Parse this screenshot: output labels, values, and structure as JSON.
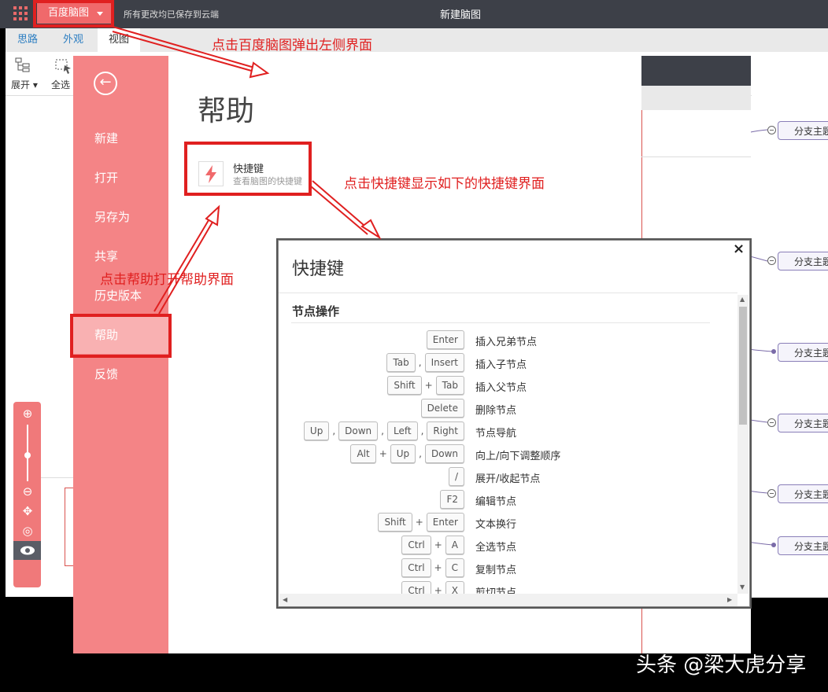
{
  "topbar": {
    "brand": "百度脑图",
    "saved_status": "所有更改均已保存到云端",
    "doc_title": "新建脑图"
  },
  "tabs": [
    {
      "label": "思路"
    },
    {
      "label": "外观"
    },
    {
      "label": "视图"
    }
  ],
  "toolbar": {
    "expand_label": "展开",
    "select_all_label": "全选"
  },
  "sidebar": {
    "items": [
      {
        "label": "新建"
      },
      {
        "label": "打开"
      },
      {
        "label": "另存为"
      },
      {
        "label": "共享"
      },
      {
        "label": "历史版本"
      },
      {
        "label": "帮助"
      },
      {
        "label": "反馈"
      }
    ]
  },
  "help_panel": {
    "title": "帮助",
    "shortcut_card": {
      "title": "快捷键",
      "subtitle": "查看脑图的快捷键"
    }
  },
  "annotations": {
    "a1": "点击百度脑图弹出左侧界面",
    "a2": "点击快捷键显示如下的快捷键界面",
    "a3": "点击帮助打开帮助界面"
  },
  "dialog": {
    "title": "快捷键",
    "close": "×",
    "section": "节点操作",
    "rows": [
      {
        "keys": [
          "Enter"
        ],
        "seps": [],
        "desc": "插入兄弟节点"
      },
      {
        "keys": [
          "Tab",
          "Insert"
        ],
        "seps": [
          ","
        ],
        "desc": "插入子节点"
      },
      {
        "keys": [
          "Shift",
          "Tab"
        ],
        "seps": [
          "+"
        ],
        "desc": "插入父节点"
      },
      {
        "keys": [
          "Delete"
        ],
        "seps": [],
        "desc": "删除节点"
      },
      {
        "keys": [
          "Up",
          "Down",
          "Left",
          "Right"
        ],
        "seps": [
          ",",
          ",",
          ","
        ],
        "desc": "节点导航"
      },
      {
        "keys": [
          "Alt",
          "Up",
          "Down"
        ],
        "seps": [
          "+",
          ","
        ],
        "desc": "向上/向下调整顺序"
      },
      {
        "keys": [
          "/"
        ],
        "seps": [],
        "desc": "展开/收起节点"
      },
      {
        "keys": [
          "F2"
        ],
        "seps": [],
        "desc": "编辑节点"
      },
      {
        "keys": [
          "Shift",
          "Enter"
        ],
        "seps": [
          "+"
        ],
        "desc": "文本换行"
      },
      {
        "keys": [
          "Ctrl",
          "A"
        ],
        "seps": [
          "+"
        ],
        "desc": "全选节点"
      },
      {
        "keys": [
          "Ctrl",
          "C"
        ],
        "seps": [
          "+"
        ],
        "desc": "复制节点"
      },
      {
        "keys": [
          "Ctrl",
          "X"
        ],
        "seps": [
          "+"
        ],
        "desc": "剪切节点"
      }
    ]
  },
  "canvas": {
    "branch_label": "分支主题"
  },
  "watermark": "头条 @梁大虎分享",
  "colors": {
    "accent": "#f0696b",
    "sidebar": "#f48486",
    "annotation": "#e02020",
    "topbar": "#3d4048"
  }
}
